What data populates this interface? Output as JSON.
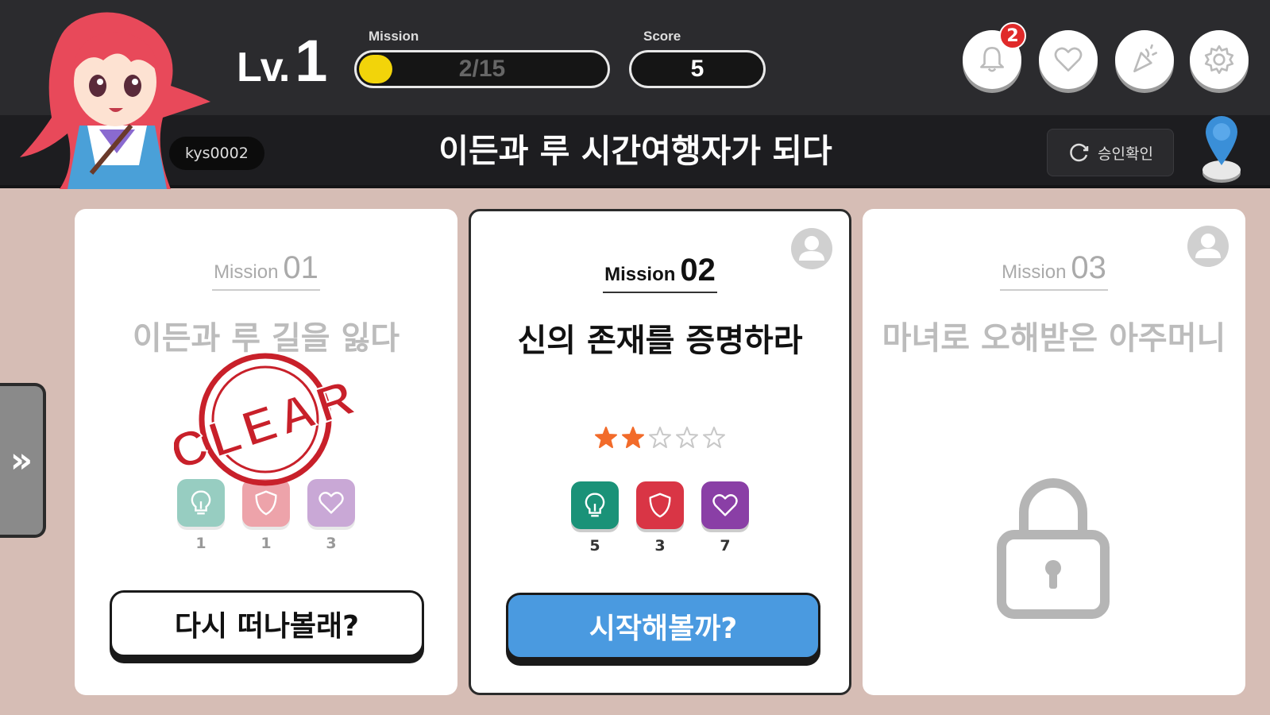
{
  "header": {
    "level_prefix": "Lv.",
    "level_number": "1",
    "mission_label": "Mission",
    "mission_progress_text": "2/15",
    "mission_progress_fraction": 0.133,
    "score_label": "Score",
    "score_value": "5",
    "notification_count": "2"
  },
  "subheader": {
    "username": "kys0002",
    "story_title": "이든과 루 시간여행자가 되다",
    "confirm_label": "승인확인"
  },
  "side_tab": {
    "label": "»"
  },
  "cards": [
    {
      "mission_word": "Mission",
      "mission_number": "01",
      "title": "이든과 루 길을 잃다",
      "stamp_text": "CLEAR",
      "stats": [
        "1",
        "1",
        "3"
      ],
      "button_label": "다시 떠나볼래?"
    },
    {
      "mission_word": "Mission",
      "mission_number": "02",
      "title": "신의 존재를 증명하라",
      "stars_filled": 2,
      "stars_total": 5,
      "stats": [
        "5",
        "3",
        "7"
      ],
      "button_label": "시작해볼까?"
    },
    {
      "mission_word": "Mission",
      "mission_number": "03",
      "title": "마녀로 오해받은 아주머니",
      "locked": true
    }
  ],
  "colors": {
    "topbar": "#2b2b2e",
    "background": "#d6bdb5",
    "progress_fill": "#f2d40a",
    "start_button": "#4a9ae0",
    "hint_green": "#1a9278",
    "shield_red": "#d93545",
    "heart_purple": "#8a3fa6",
    "star_orange": "#f26b2a",
    "stamp_red": "#c8202a"
  }
}
